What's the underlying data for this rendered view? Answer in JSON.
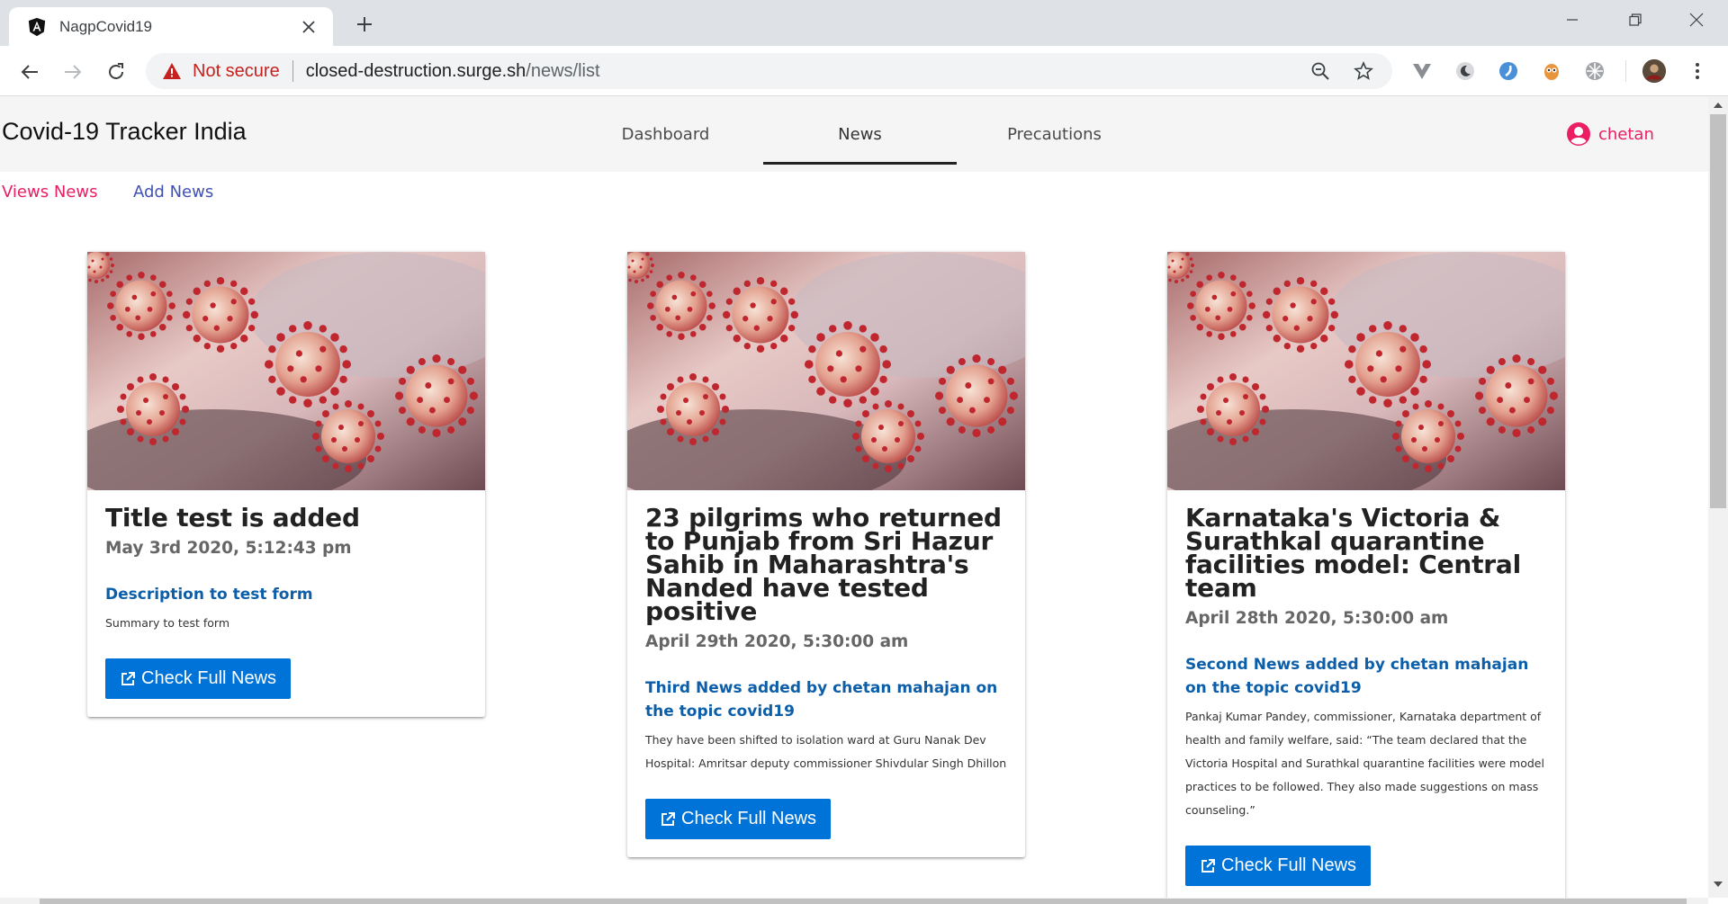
{
  "browser": {
    "tab_title": "NagpCovid19",
    "security_label": "Not secure",
    "url_host": "closed-destruction.surge.sh",
    "url_path": "/news/list"
  },
  "header": {
    "brand": "Covid-19 Tracker India",
    "nav": [
      "Dashboard",
      "News",
      "Precautions"
    ],
    "active_nav": "News",
    "user": "chetan"
  },
  "subnav": {
    "view_news": "Views News",
    "add_news": "Add News"
  },
  "cards": [
    {
      "title": "Title test is added",
      "date": "May 3rd 2020, 5:12:43 pm",
      "description": "Description to test form",
      "summary": "Summary to test form",
      "button": "Check Full News"
    },
    {
      "title": "23 pilgrims who returned to Punjab from Sri Hazur Sahib in Maharashtra's Nanded have tested positive",
      "date": "April 29th 2020, 5:30:00 am",
      "description": "Third News added by chetan mahajan on the topic covid19",
      "summary": "They have been shifted to isolation ward at Guru Nanak Dev Hospital: Amritsar deputy commissioner Shivdular Singh Dhillon",
      "button": "Check Full News"
    },
    {
      "title": "Karnataka's Victoria & Surathkal quarantine facilities model: Central team",
      "date": "April 28th 2020, 5:30:00 am",
      "description": "Second News added by chetan mahajan on the topic covid19",
      "summary": "Pankaj Kumar Pandey, commissioner, Karnataka department of health and family welfare, said: “The team declared that the Victoria Hospital and Surathkal quarantine facilities were model practices to be followed. They also made suggestions on mass counseling.”",
      "button": "Check Full News"
    }
  ],
  "colors": {
    "accent_pink": "#e91e63",
    "link_indigo": "#3f51b5",
    "button_blue": "#0073d9",
    "description_blue": "#0d5ea8"
  }
}
